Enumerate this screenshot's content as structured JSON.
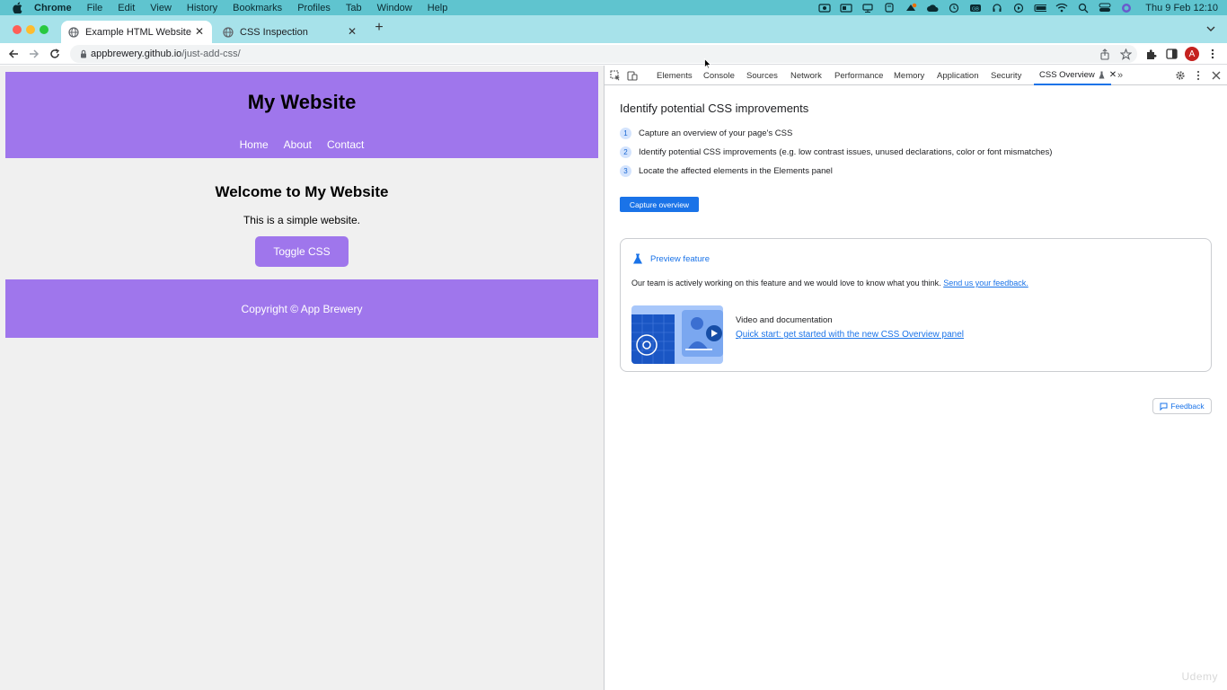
{
  "menubar": {
    "app": "Chrome",
    "items": [
      "File",
      "Edit",
      "View",
      "History",
      "Bookmarks",
      "Profiles",
      "Tab",
      "Window",
      "Help"
    ],
    "clock": "Thu 9 Feb  12:10"
  },
  "tabs": [
    {
      "title": "Example HTML Website",
      "active": true
    },
    {
      "title": "CSS Inspection",
      "active": false
    }
  ],
  "address": {
    "host": "appbrewery.github.io",
    "path": "/just-add-css/"
  },
  "profile_initial": "A",
  "site": {
    "title": "My Website",
    "nav": [
      "Home",
      "About",
      "Contact"
    ],
    "welcome": "Welcome to My Website",
    "description": "This is a simple website.",
    "toggle_button": "Toggle CSS",
    "footer": "Copyright © App Brewery",
    "accent": "#9f76ec"
  },
  "devtools": {
    "tabs": [
      "Elements",
      "Console",
      "Sources",
      "Network",
      "Performance",
      "Memory",
      "Application",
      "Security",
      "CSS Overview"
    ],
    "active_tab": "CSS Overview",
    "heading": "Identify potential CSS improvements",
    "steps": [
      {
        "num": "1",
        "text": "Capture an overview of your page's CSS"
      },
      {
        "num": "2",
        "text": "Identify potential CSS improvements (e.g. low contrast issues, unused declarations, color or font mismatches)"
      },
      {
        "num": "3",
        "text": "Locate the affected elements in the Elements panel"
      }
    ],
    "capture_button": "Capture overview",
    "preview": {
      "title": "Preview feature",
      "text": "Our team is actively working on this feature and we would love to know what you think.",
      "feedback_link": "Send us your feedback.",
      "video_label": "Video and documentation",
      "video_link": "Quick start: get started with the new CSS Overview panel"
    },
    "feedback_button": "Feedback",
    "accent": "#1a73e8"
  },
  "watermark": "Udemy"
}
